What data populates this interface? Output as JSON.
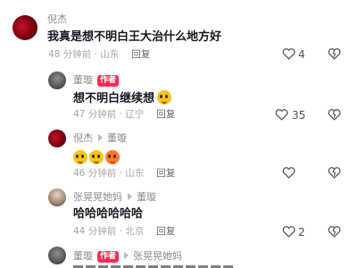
{
  "comments": [
    {
      "author": "倪杰",
      "text": "我真是想不明白王大治什么地方好",
      "time": "48 分钟前 · 山东",
      "reply": "回复",
      "likes": "4"
    },
    {
      "author": "董璇",
      "badge": "作者",
      "text": "想不明白继续想",
      "time": "47 分钟前 · 辽宁",
      "reply": "回复",
      "likes": "35"
    },
    {
      "author": "倪杰",
      "reply_to": "董璇",
      "time": "46 分钟前 · 山东",
      "reply": "回复",
      "likes": ""
    },
    {
      "author": "张晃晃她妈",
      "reply_to": "董璇",
      "text": "哈哈哈哈哈哈",
      "time": "44 分钟前 · 北京",
      "reply": "回复",
      "likes": "2"
    },
    {
      "author": "董璇",
      "badge": "作者",
      "reply_to": "张晃晃她妈",
      "text": "",
      "time": "",
      "reply": "",
      "likes": ""
    }
  ],
  "colors": {
    "badge": "#fe2c55",
    "name": "#8a8b91",
    "body": "#161823"
  }
}
